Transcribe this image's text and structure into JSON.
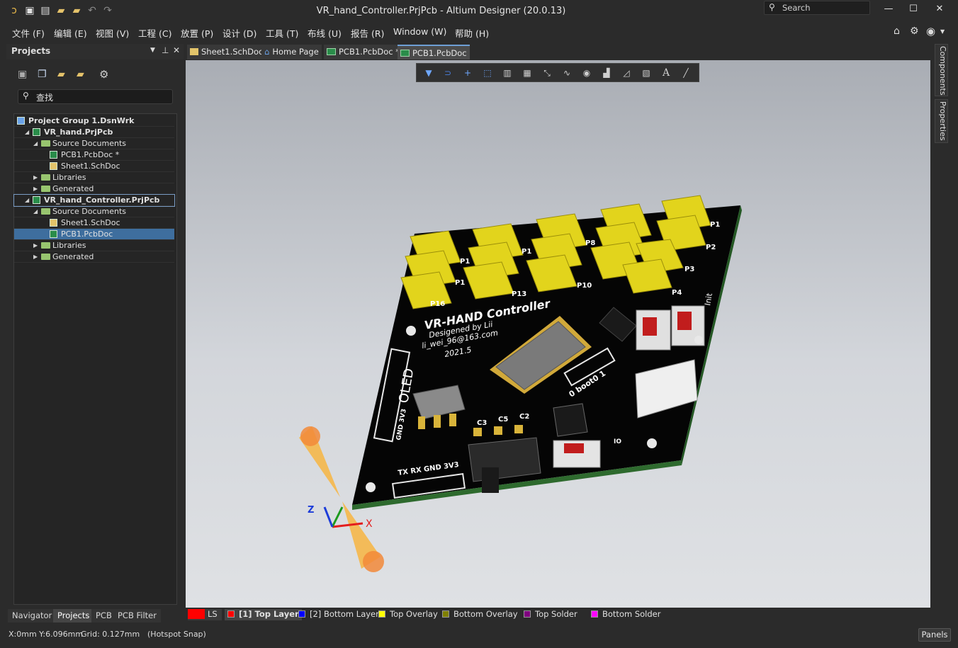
{
  "window": {
    "title": "VR_hand_Controller.PrjPcb - Altium Designer (20.0.13)",
    "search_placeholder": "Search"
  },
  "menu": [
    "文件 (F)",
    "编辑 (E)",
    "视图 (V)",
    "工程 (C)",
    "放置 (P)",
    "设计 (D)",
    "工具 (T)",
    "布线 (U)",
    "报告 (R)",
    "Window (W)",
    "帮助 (H)"
  ],
  "projects_panel": {
    "title": "Projects",
    "search_placeholder": "查找",
    "tree": [
      {
        "label": "Project Group 1.DsnWrk",
        "level": 0,
        "icon": "group",
        "bold": true
      },
      {
        "label": "VR_hand.PrjPcb",
        "level": 1,
        "icon": "project",
        "bold": true,
        "expanded": true
      },
      {
        "label": "Source Documents",
        "level": 2,
        "icon": "folder",
        "expanded": true
      },
      {
        "label": "PCB1.PcbDoc *",
        "level": 3,
        "icon": "pcb"
      },
      {
        "label": "Sheet1.SchDoc",
        "level": 3,
        "icon": "sch"
      },
      {
        "label": "Libraries",
        "level": 2,
        "icon": "folder",
        "expanded": false
      },
      {
        "label": "Generated",
        "level": 2,
        "icon": "folder",
        "expanded": false
      },
      {
        "label": "VR_hand_Controller.PrjPcb",
        "level": 1,
        "icon": "project",
        "bold": true,
        "expanded": true,
        "active": true
      },
      {
        "label": "Source Documents",
        "level": 2,
        "icon": "folder",
        "expanded": true
      },
      {
        "label": "Sheet1.SchDoc",
        "level": 3,
        "icon": "sch"
      },
      {
        "label": "PCB1.PcbDoc",
        "level": 3,
        "icon": "pcb",
        "selected": true
      },
      {
        "label": "Libraries",
        "level": 2,
        "icon": "folder",
        "expanded": false
      },
      {
        "label": "Generated",
        "level": 2,
        "icon": "folder",
        "expanded": false
      }
    ],
    "bottom_tabs": [
      "Navigator",
      "Projects",
      "PCB",
      "PCB Filter"
    ]
  },
  "doc_tabs": [
    "Sheet1.SchDoc",
    "Home Page",
    "PCB1.PcbDoc *",
    "PCB1.PcbDoc"
  ],
  "side_tabs": [
    "Components",
    "Properties"
  ],
  "board": {
    "title": "VR-HAND Controller",
    "line1": "Desigened by Lii",
    "line2": "li_wei_96@163.com",
    "line3": "2021.5",
    "oled": "OLED",
    "boot": "0  boot0  1",
    "labels_left": [
      "P16",
      "P1",
      "P1"
    ],
    "labels_mid": [
      "P13",
      "P10"
    ],
    "labels_right": [
      "P1",
      "P2",
      "P3",
      "P4"
    ],
    "caps": [
      "C3",
      "C5",
      "C2"
    ],
    "uart": "TX RX GND 3V3",
    "oled_pins": "GND 3V3",
    "init": "Init",
    "io": "IO",
    "mark1": "P1",
    "mark2": "P8"
  },
  "layers": [
    {
      "name": "LS",
      "color": "#ff0000"
    },
    {
      "name": "[1] Top Layer",
      "color": "#ff0000"
    },
    {
      "name": "[2] Bottom Layer",
      "color": "#0000ff"
    },
    {
      "name": "Top Overlay",
      "color": "#ffff00"
    },
    {
      "name": "Bottom Overlay",
      "color": "#808000"
    },
    {
      "name": "Top Solder",
      "color": "#800080"
    },
    {
      "name": "Bottom Solder",
      "color": "#ff00ff"
    }
  ],
  "status": {
    "coords": "X:0mm Y:6.096mm",
    "grid": "Grid: 0.127mm",
    "snap": "(Hotspot Snap)",
    "panels": "Panels"
  },
  "axes": {
    "x": "X",
    "z": "Z"
  }
}
